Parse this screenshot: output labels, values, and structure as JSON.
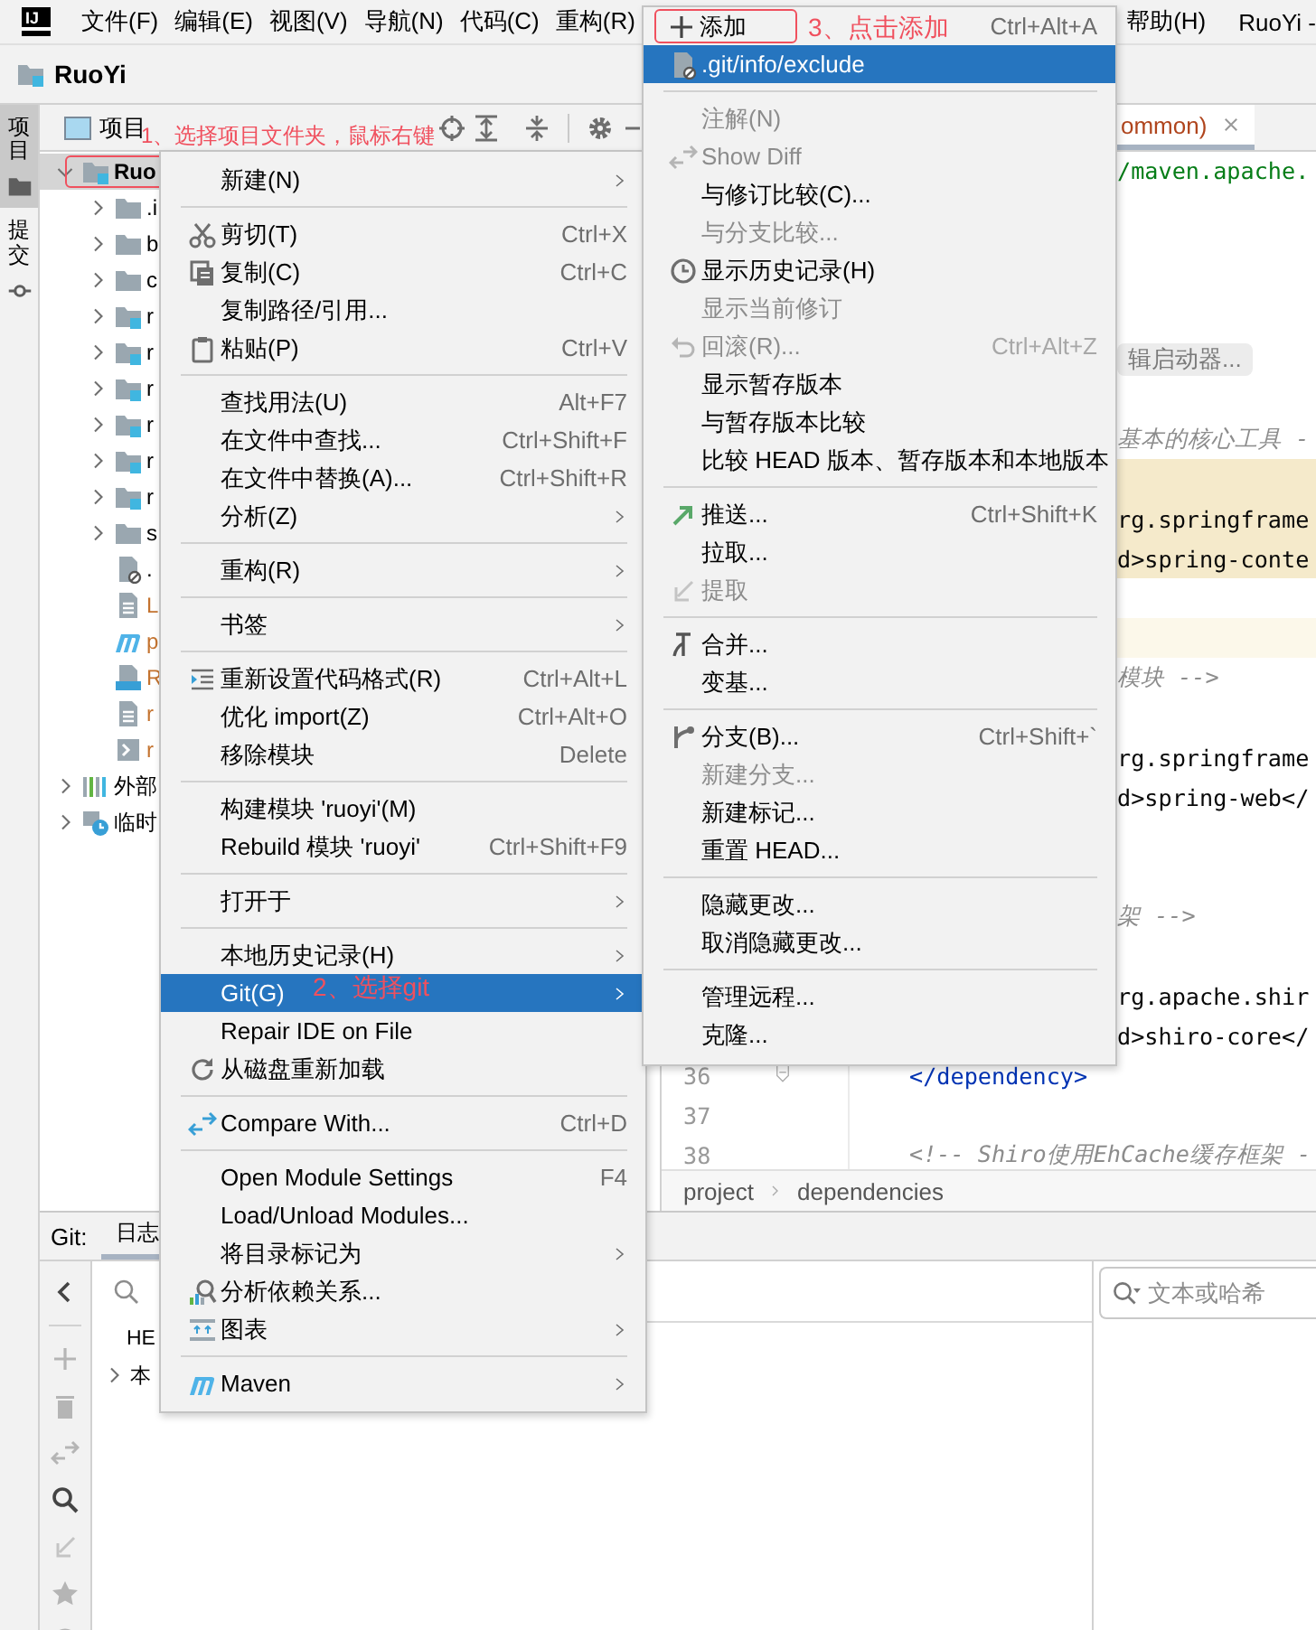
{
  "menu_bar": {
    "logo": "IJ",
    "items": [
      "文件(F)",
      "编辑(E)",
      "视图(V)",
      "导航(N)",
      "代码(C)",
      "重构(R)"
    ],
    "right_items": [
      "帮助(H)"
    ],
    "window_title": "RuoYi -"
  },
  "navigation_bar": {
    "project": "RuoYi"
  },
  "tool_stripe": [
    {
      "label": "项目",
      "selected": true
    },
    {
      "label": "提交",
      "selected": false
    }
  ],
  "project_panel": {
    "title": "项目",
    "tree": [
      {
        "label": "Ruo",
        "kind": "module",
        "selected": true,
        "expanded": true,
        "boxed": true,
        "color": "#000000",
        "children": [
          {
            "label": ".i",
            "kind": "folder",
            "selected": false,
            "expanded": false,
            "boxed": false,
            "color": "#000000"
          },
          {
            "label": "b",
            "kind": "folder",
            "selected": false,
            "expanded": false,
            "boxed": false,
            "color": "#000000"
          },
          {
            "label": "c",
            "kind": "folder",
            "selected": false,
            "expanded": false,
            "boxed": false,
            "color": "#000000"
          },
          {
            "label": "r",
            "kind": "module",
            "selected": false,
            "expanded": false,
            "boxed": false,
            "color": "#000000"
          },
          {
            "label": "r",
            "kind": "module",
            "selected": false,
            "expanded": false,
            "boxed": false,
            "color": "#000000"
          },
          {
            "label": "r",
            "kind": "module",
            "selected": false,
            "expanded": false,
            "boxed": false,
            "color": "#000000"
          },
          {
            "label": "r",
            "kind": "module",
            "selected": false,
            "expanded": false,
            "boxed": false,
            "color": "#000000"
          },
          {
            "label": "r",
            "kind": "module",
            "selected": false,
            "expanded": false,
            "boxed": false,
            "color": "#000000"
          },
          {
            "label": "r",
            "kind": "module",
            "selected": false,
            "expanded": false,
            "boxed": false,
            "color": "#000000"
          },
          {
            "label": "s",
            "kind": "folder",
            "selected": false,
            "expanded": false,
            "boxed": false,
            "color": "#000000"
          },
          {
            "label": ".",
            "kind": "ignored-file",
            "selected": false,
            "boxed": false
          },
          {
            "label": "L",
            "kind": "text-file",
            "selected": false,
            "boxed": false,
            "color": "#c4732f"
          },
          {
            "label": "p",
            "kind": "maven",
            "selected": false,
            "boxed": false,
            "color": "#c4732f"
          },
          {
            "label": "R",
            "kind": "md-file",
            "selected": false,
            "boxed": false,
            "color": "#c4732f"
          },
          {
            "label": "r",
            "kind": "text-file",
            "selected": false,
            "boxed": false,
            "color": "#c4732f"
          },
          {
            "label": "r",
            "kind": "script",
            "selected": false,
            "boxed": false,
            "color": "#c4732f"
          }
        ]
      },
      {
        "label": "外部",
        "kind": "libraries",
        "selected": false,
        "expanded": false,
        "boxed": false,
        "color": "#000000"
      },
      {
        "label": "临时",
        "kind": "scratches",
        "selected": false,
        "expanded": false,
        "boxed": false,
        "color": "#000000"
      }
    ]
  },
  "editor": {
    "tab": {
      "label": "ommon)",
      "selected": true
    },
    "lines": [
      {
        "kind": "string",
        "text": "/maven.apache.",
        "highlighted": false,
        "current": false
      },
      {
        "kind": "blank",
        "highlighted": false,
        "current": false
      },
      {
        "kind": "blank",
        "highlighted": false,
        "current": false
      },
      {
        "kind": "blank",
        "highlighted": false,
        "current": false
      },
      {
        "kind": "blank",
        "highlighted": false,
        "current": false
      },
      {
        "kind": "hint",
        "text": "辑启动器...",
        "highlighted": false,
        "current": false
      },
      {
        "kind": "blank",
        "highlighted": false,
        "current": false
      },
      {
        "kind": "comment",
        "text": "基本的核心工具 -",
        "highlighted": false,
        "current": false
      },
      {
        "kind": "blank",
        "highlighted": true,
        "current": false
      },
      {
        "kind": "code",
        "text": "rg.springframe",
        "highlighted": true,
        "current": false
      },
      {
        "kind": "code",
        "text": "d>spring-conte",
        "highlighted": true,
        "current": false
      },
      {
        "kind": "blank",
        "highlighted": false,
        "current": false
      },
      {
        "kind": "blank",
        "highlighted": false,
        "current": true
      },
      {
        "kind": "comment",
        "text": "模块 -->",
        "highlighted": false,
        "current": false
      },
      {
        "kind": "blank",
        "highlighted": false,
        "current": false
      },
      {
        "kind": "code",
        "text": "rg.springframe",
        "highlighted": false,
        "current": false
      },
      {
        "kind": "code",
        "text": "d>spring-web</",
        "highlighted": false,
        "current": false
      },
      {
        "kind": "blank",
        "highlighted": false,
        "current": false
      },
      {
        "kind": "blank",
        "highlighted": false,
        "current": false
      },
      {
        "kind": "comment",
        "text": "架 -->",
        "highlighted": false,
        "current": false
      },
      {
        "kind": "blank",
        "highlighted": false,
        "current": false
      },
      {
        "kind": "code",
        "text": "rg.apache.shir",
        "highlighted": false,
        "current": false
      },
      {
        "kind": "code",
        "text": "d>shiro-core</",
        "highlighted": false,
        "current": false
      },
      {
        "kind": "tag",
        "number": "36",
        "text": "</dependency>",
        "highlighted": false,
        "current": false
      },
      {
        "kind": "blank",
        "number": "37",
        "highlighted": false,
        "current": false
      },
      {
        "kind": "comment",
        "number": "38",
        "text": "<!-- Shiro使用EhCache缓存框架 -",
        "highlighted": false,
        "current": false
      }
    ],
    "breadcrumbs": [
      "project",
      "dependencies"
    ]
  },
  "git_panel": {
    "title": "Git:",
    "tabs": [
      {
        "label": "日志",
        "selected": true
      }
    ],
    "branches": [
      {
        "label": "HE",
        "kind": "ref"
      },
      {
        "label": "本",
        "kind": "group",
        "expanded": false
      }
    ],
    "search": {
      "placeholder": "文本或哈希"
    }
  },
  "context_menu": {
    "items": [
      {
        "kind": "item",
        "label": "新建(N)",
        "submenu": true,
        "disabled": false,
        "selected": false
      },
      {
        "kind": "separator"
      },
      {
        "kind": "item",
        "label": "剪切(T)",
        "shortcut": "Ctrl+X",
        "submenu": false,
        "disabled": false,
        "selected": false
      },
      {
        "kind": "item",
        "label": "复制(C)",
        "shortcut": "Ctrl+C",
        "submenu": false,
        "disabled": false,
        "selected": false
      },
      {
        "kind": "item",
        "label": "复制路径/引用...",
        "submenu": false,
        "disabled": false,
        "selected": false
      },
      {
        "kind": "item",
        "label": "粘贴(P)",
        "shortcut": "Ctrl+V",
        "submenu": false,
        "disabled": false,
        "selected": false
      },
      {
        "kind": "separator"
      },
      {
        "kind": "item",
        "label": "查找用法(U)",
        "shortcut": "Alt+F7",
        "submenu": false,
        "disabled": false,
        "selected": false
      },
      {
        "kind": "item",
        "label": "在文件中查找...",
        "shortcut": "Ctrl+Shift+F",
        "submenu": false,
        "disabled": false,
        "selected": false
      },
      {
        "kind": "item",
        "label": "在文件中替换(A)...",
        "shortcut": "Ctrl+Shift+R",
        "submenu": false,
        "disabled": false,
        "selected": false
      },
      {
        "kind": "item",
        "label": "分析(Z)",
        "submenu": true,
        "disabled": false,
        "selected": false
      },
      {
        "kind": "separator"
      },
      {
        "kind": "item",
        "label": "重构(R)",
        "submenu": true,
        "disabled": false,
        "selected": false
      },
      {
        "kind": "separator"
      },
      {
        "kind": "item",
        "label": "书签",
        "submenu": true,
        "disabled": false,
        "selected": false
      },
      {
        "kind": "separator"
      },
      {
        "kind": "item",
        "label": "重新设置代码格式(R)",
        "shortcut": "Ctrl+Alt+L",
        "submenu": false,
        "disabled": false,
        "selected": false
      },
      {
        "kind": "item",
        "label": "优化 import(Z)",
        "shortcut": "Ctrl+Alt+O",
        "submenu": false,
        "disabled": false,
        "selected": false
      },
      {
        "kind": "item",
        "label": "移除模块",
        "shortcut": "Delete",
        "submenu": false,
        "disabled": false,
        "selected": false
      },
      {
        "kind": "separator"
      },
      {
        "kind": "item",
        "label": "构建模块 'ruoyi'(M)",
        "submenu": false,
        "disabled": false,
        "selected": false
      },
      {
        "kind": "item",
        "label": "Rebuild 模块 'ruoyi'",
        "shortcut": "Ctrl+Shift+F9",
        "submenu": false,
        "disabled": false,
        "selected": false
      },
      {
        "kind": "separator"
      },
      {
        "kind": "item",
        "label": "打开于",
        "submenu": true,
        "disabled": false,
        "selected": false
      },
      {
        "kind": "separator"
      },
      {
        "kind": "item",
        "label": "本地历史记录(H)",
        "submenu": true,
        "disabled": false,
        "selected": false
      },
      {
        "kind": "item",
        "label": "Git(G)",
        "submenu": true,
        "disabled": false,
        "selected": true
      },
      {
        "kind": "item",
        "label": "Repair IDE on File",
        "submenu": false,
        "disabled": false,
        "selected": false
      },
      {
        "kind": "item",
        "label": "从磁盘重新加载",
        "submenu": false,
        "disabled": false,
        "selected": false
      },
      {
        "kind": "separator"
      },
      {
        "kind": "item",
        "label": "Compare With...",
        "shortcut": "Ctrl+D",
        "submenu": false,
        "disabled": false,
        "selected": false
      },
      {
        "kind": "separator"
      },
      {
        "kind": "item",
        "label": "Open Module Settings",
        "shortcut": "F4",
        "submenu": false,
        "disabled": false,
        "selected": false
      },
      {
        "kind": "item",
        "label": "Load/Unload Modules...",
        "submenu": false,
        "disabled": false,
        "selected": false
      },
      {
        "kind": "item",
        "label": "将目录标记为",
        "submenu": true,
        "disabled": false,
        "selected": false
      },
      {
        "kind": "item",
        "label": "分析依赖关系...",
        "submenu": false,
        "disabled": false,
        "selected": false
      },
      {
        "kind": "item",
        "label": "图表",
        "submenu": true,
        "disabled": false,
        "selected": false
      },
      {
        "kind": "separator"
      },
      {
        "kind": "item",
        "label": "Maven",
        "submenu": true,
        "disabled": false,
        "selected": false
      }
    ]
  },
  "git_submenu": {
    "items": [
      {
        "kind": "item",
        "label": "添加",
        "shortcut": "Ctrl+Alt+A",
        "submenu": false,
        "disabled": false,
        "selected": false,
        "boxed": true
      },
      {
        "kind": "item",
        "label": ".git/info/exclude",
        "submenu": false,
        "disabled": false,
        "selected": true,
        "boxed": false
      },
      {
        "kind": "separator"
      },
      {
        "kind": "item",
        "label": "注解(N)",
        "submenu": false,
        "disabled": true,
        "selected": false,
        "boxed": false
      },
      {
        "kind": "item",
        "label": "Show Diff",
        "submenu": false,
        "disabled": true,
        "selected": false,
        "boxed": false
      },
      {
        "kind": "item",
        "label": "与修订比较(C)...",
        "submenu": false,
        "disabled": false,
        "selected": false,
        "boxed": false
      },
      {
        "kind": "item",
        "label": "与分支比较...",
        "submenu": false,
        "disabled": true,
        "selected": false,
        "boxed": false
      },
      {
        "kind": "item",
        "label": "显示历史记录(H)",
        "submenu": false,
        "disabled": false,
        "selected": false,
        "boxed": false
      },
      {
        "kind": "item",
        "label": "显示当前修订",
        "submenu": false,
        "disabled": true,
        "selected": false,
        "boxed": false
      },
      {
        "kind": "item",
        "label": "回滚(R)...",
        "shortcut": "Ctrl+Alt+Z",
        "submenu": false,
        "disabled": true,
        "selected": false,
        "boxed": false
      },
      {
        "kind": "item",
        "label": "显示暂存版本",
        "submenu": false,
        "disabled": false,
        "selected": false,
        "boxed": false
      },
      {
        "kind": "item",
        "label": "与暂存版本比较",
        "submenu": false,
        "disabled": false,
        "selected": false,
        "boxed": false
      },
      {
        "kind": "item",
        "label": "比较 HEAD 版本、暂存版本和本地版本",
        "submenu": false,
        "disabled": false,
        "selected": false,
        "boxed": false
      },
      {
        "kind": "separator"
      },
      {
        "kind": "item",
        "label": "推送...",
        "shortcut": "Ctrl+Shift+K",
        "submenu": false,
        "disabled": false,
        "selected": false,
        "boxed": false
      },
      {
        "kind": "item",
        "label": "拉取...",
        "submenu": false,
        "disabled": false,
        "selected": false,
        "boxed": false
      },
      {
        "kind": "item",
        "label": "提取",
        "submenu": false,
        "disabled": true,
        "selected": false,
        "boxed": false
      },
      {
        "kind": "separator"
      },
      {
        "kind": "item",
        "label": "合并...",
        "submenu": false,
        "disabled": false,
        "selected": false,
        "boxed": false
      },
      {
        "kind": "item",
        "label": "变基...",
        "submenu": false,
        "disabled": false,
        "selected": false,
        "boxed": false
      },
      {
        "kind": "separator"
      },
      {
        "kind": "item",
        "label": "分支(B)...",
        "shortcut": "Ctrl+Shift+`",
        "submenu": false,
        "disabled": false,
        "selected": false,
        "boxed": false
      },
      {
        "kind": "item",
        "label": "新建分支...",
        "submenu": false,
        "disabled": true,
        "selected": false,
        "boxed": false
      },
      {
        "kind": "item",
        "label": "新建标记...",
        "submenu": false,
        "disabled": false,
        "selected": false,
        "boxed": false
      },
      {
        "kind": "item",
        "label": "重置 HEAD...",
        "submenu": false,
        "disabled": false,
        "selected": false,
        "boxed": false
      },
      {
        "kind": "separator"
      },
      {
        "kind": "item",
        "label": "隐藏更改...",
        "submenu": false,
        "disabled": false,
        "selected": false,
        "boxed": false
      },
      {
        "kind": "item",
        "label": "取消隐藏更改...",
        "submenu": false,
        "disabled": false,
        "selected": false,
        "boxed": false
      },
      {
        "kind": "separator"
      },
      {
        "kind": "item",
        "label": "管理远程...",
        "submenu": false,
        "disabled": false,
        "selected": false,
        "boxed": false
      },
      {
        "kind": "item",
        "label": "克隆...",
        "submenu": false,
        "disabled": false,
        "selected": false,
        "boxed": false
      }
    ]
  },
  "annotations": [
    {
      "text": "1、选择项目文件夹，鼠标右键"
    },
    {
      "text": "2、选择git"
    },
    {
      "text": "3、点击添加"
    }
  ]
}
